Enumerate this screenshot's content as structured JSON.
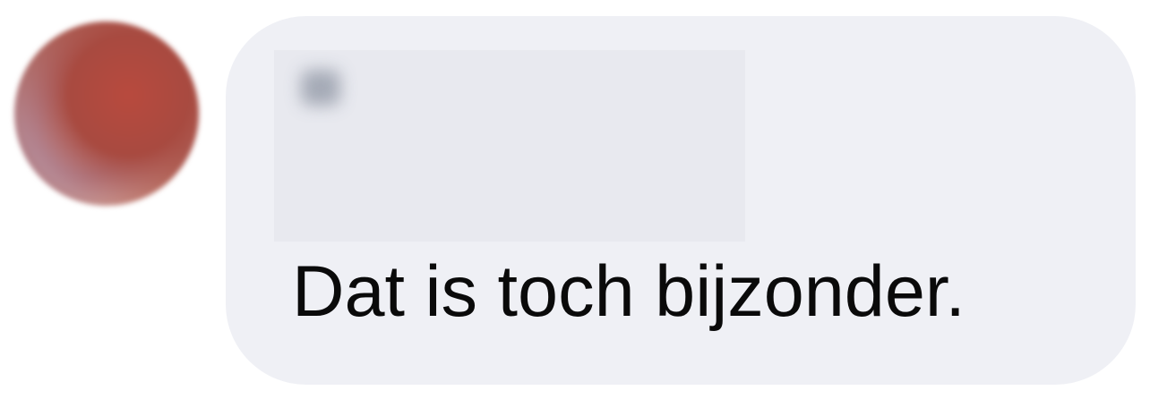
{
  "message": {
    "text": "Dat is toch bijzonder.",
    "reply_preview": {
      "name": "",
      "quote": ""
    }
  },
  "colors": {
    "bubble_background": "#eff0f5",
    "reply_block_background": "#e8e9ef",
    "text": "#0a0a0a"
  }
}
